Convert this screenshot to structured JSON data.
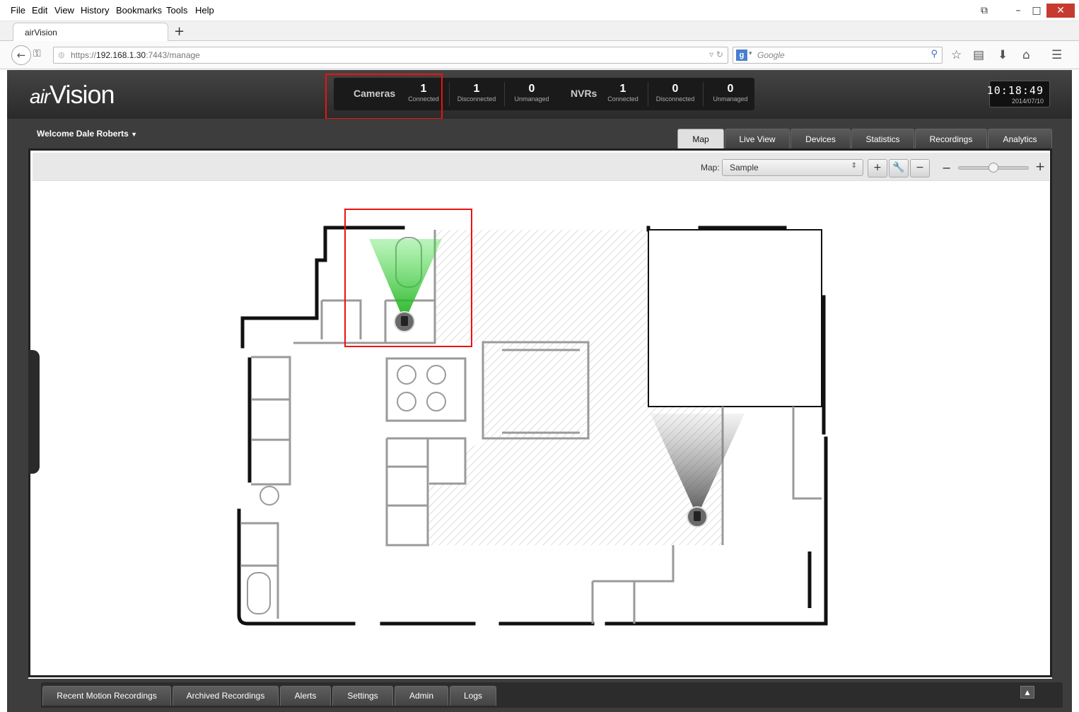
{
  "browser": {
    "menu": [
      "File",
      "Edit",
      "View",
      "History",
      "Bookmarks",
      "Tools",
      "Help"
    ],
    "tab_title": "airVision",
    "new_tab": "+",
    "url_prefix": "https://",
    "url_host": "192.168.1.30",
    "url_rest": ":7443/manage",
    "search_placeholder": "Google",
    "search_engine_icon": "google-icon"
  },
  "app": {
    "logo_air": "air",
    "logo_vision": "Vision",
    "cameras": {
      "label": "Cameras",
      "connected": "1",
      "connected_label": "Connected",
      "disconnected": "1",
      "disconnected_label": "Disconnected",
      "unmanaged": "0",
      "unmanaged_label": "Unmanaged"
    },
    "nvrs": {
      "label": "NVRs",
      "connected": "1",
      "connected_label": "Connected",
      "disconnected": "0",
      "disconnected_label": "Disconnected",
      "unmanaged": "0",
      "unmanaged_label": "Unmanaged"
    },
    "clock": {
      "time": "10:18:49",
      "date": "2014/07/10"
    },
    "welcome": "Welcome Dale Roberts",
    "tabs": [
      "Map",
      "Live View",
      "Devices",
      "Statistics",
      "Recordings",
      "Analytics"
    ],
    "active_tab": "Map"
  },
  "map": {
    "label": "Map:",
    "selected": "Sample",
    "add": "+",
    "remove": "−",
    "zoom_out": "−",
    "zoom_in": "+",
    "zoom_level": 0.5,
    "camera_connected_color": "#2fbf2f",
    "camera_disconnected_color": "#555555"
  },
  "bottom_tabs": [
    "Recent Motion Recordings",
    "Archived Recordings",
    "Alerts",
    "Settings",
    "Admin",
    "Logs"
  ],
  "colors": {
    "highlight": "#e11111",
    "header_dark": "#2a2a2a",
    "close_button": "#c73a2f"
  }
}
